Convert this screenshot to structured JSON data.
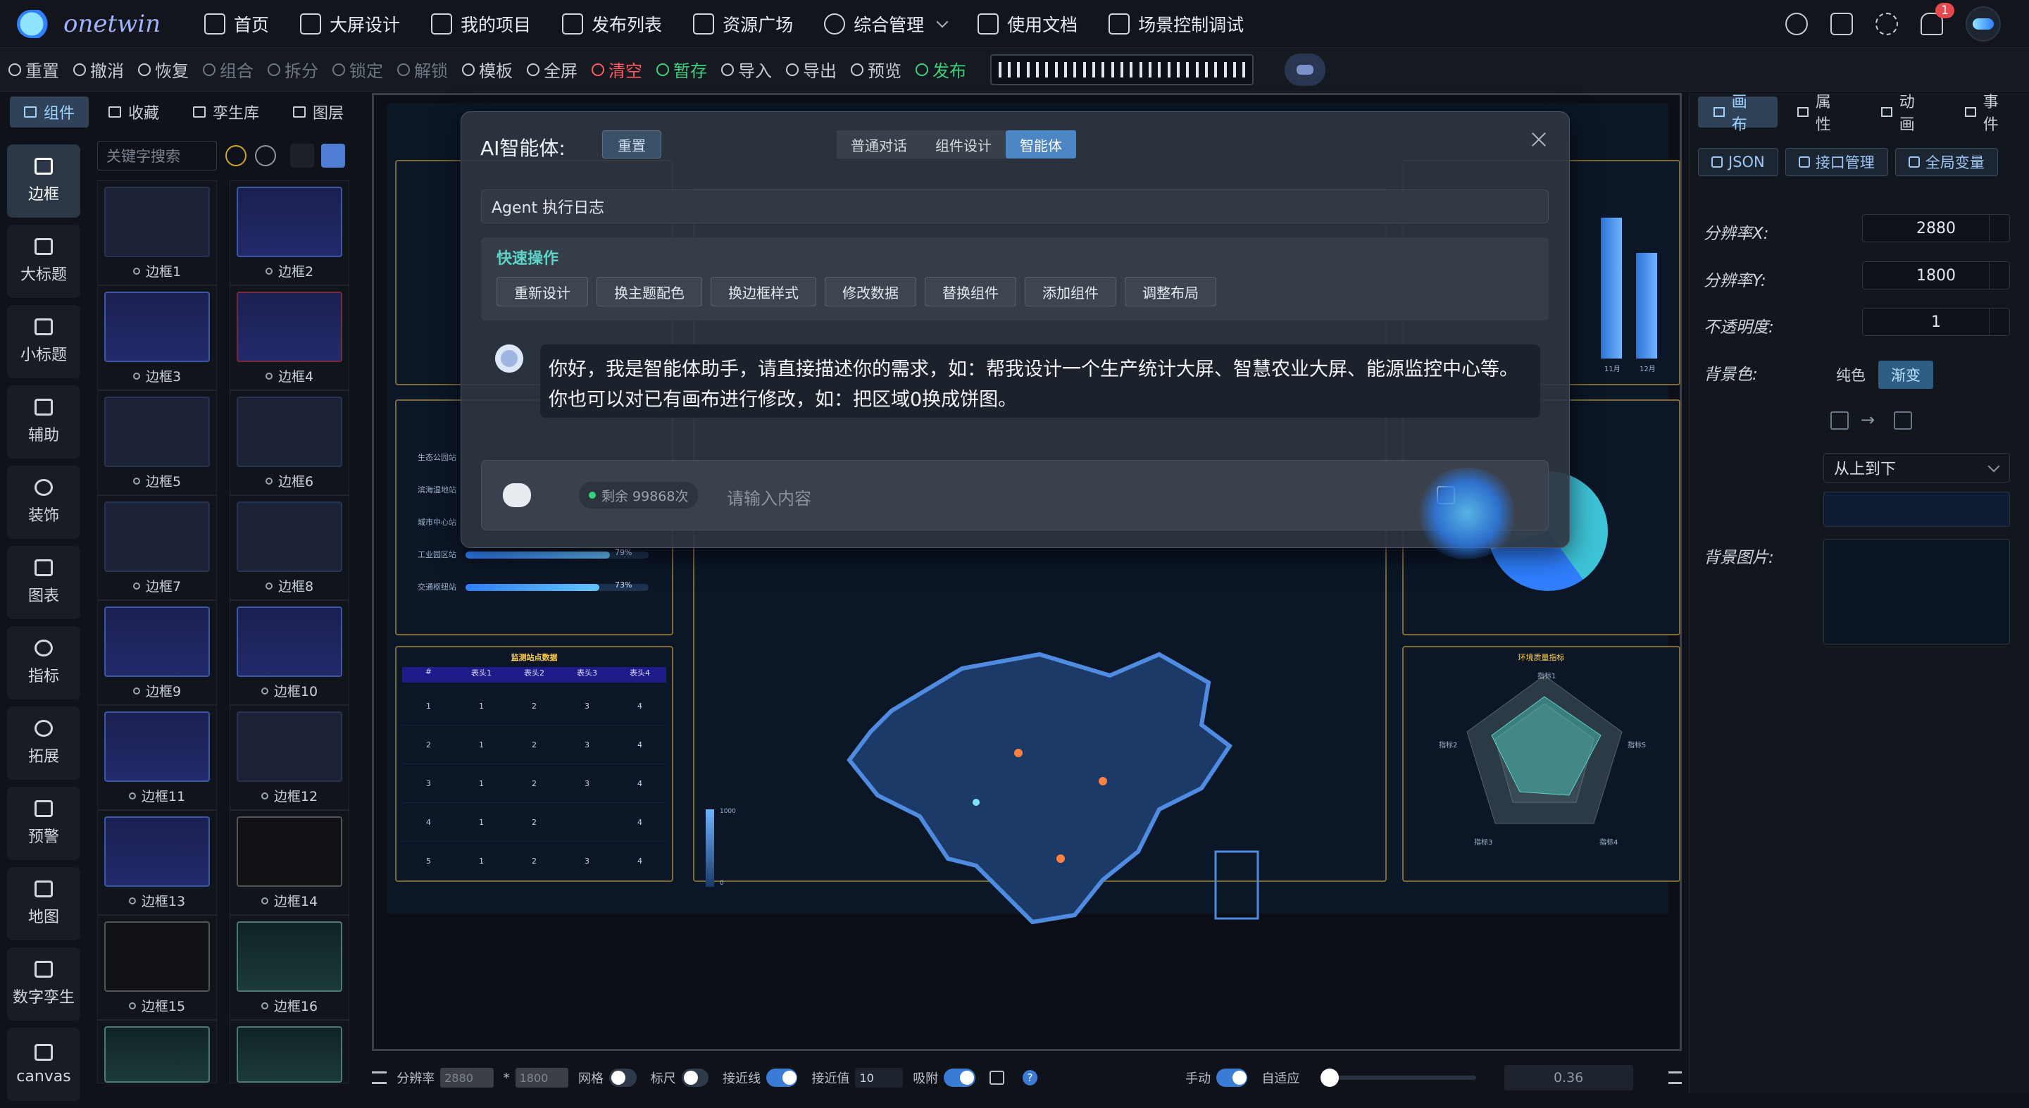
{
  "app": {
    "logo_text": "onetwin"
  },
  "nav": {
    "items": [
      {
        "label": "首页",
        "icon": "home-icon"
      },
      {
        "label": "大屏设计",
        "icon": "monitor-icon"
      },
      {
        "label": "我的项目",
        "icon": "project-icon"
      },
      {
        "label": "发布列表",
        "icon": "list-icon"
      },
      {
        "label": "资源广场",
        "icon": "grid-icon"
      },
      {
        "label": "综合管理",
        "icon": "gear-icon"
      },
      {
        "label": "使用文档",
        "icon": "doc-icon"
      },
      {
        "label": "场景控制调试",
        "icon": "screen-icon"
      }
    ],
    "notification_count": "1"
  },
  "toolbar": {
    "items": [
      {
        "label": "重置",
        "state": "normal"
      },
      {
        "label": "撤消",
        "state": "normal"
      },
      {
        "label": "恢复",
        "state": "normal"
      },
      {
        "label": "组合",
        "state": "disabled"
      },
      {
        "label": "拆分",
        "state": "disabled"
      },
      {
        "label": "锁定",
        "state": "disabled"
      },
      {
        "label": "解锁",
        "state": "disabled"
      },
      {
        "label": "模板",
        "state": "normal"
      },
      {
        "label": "全屏",
        "state": "normal"
      },
      {
        "label": "清空",
        "state": "danger"
      },
      {
        "label": "暂存",
        "state": "success"
      },
      {
        "label": "导入",
        "state": "normal"
      },
      {
        "label": "导出",
        "state": "normal"
      },
      {
        "label": "预览",
        "state": "normal"
      },
      {
        "label": "发布",
        "state": "success"
      }
    ]
  },
  "left_tabs": [
    {
      "label": "组件",
      "active": true
    },
    {
      "label": "收藏"
    },
    {
      "label": "孪生库"
    },
    {
      "label": "图层"
    }
  ],
  "categories": [
    "边框",
    "大标题",
    "小标题",
    "辅助",
    "装饰",
    "图表",
    "指标",
    "拓展",
    "预警",
    "地图",
    "数字孪生",
    "canvas"
  ],
  "search": {
    "placeholder": "关键字搜索"
  },
  "components": [
    "边框1",
    "边框2",
    "边框3",
    "边框4",
    "边框5",
    "边框6",
    "边框7",
    "边框8",
    "边框9",
    "边框10",
    "边框11",
    "边框12",
    "边框13",
    "边框14",
    "边框15",
    "边框16"
  ],
  "right_tabs": [
    {
      "label": "画布",
      "active": true
    },
    {
      "label": "属性"
    },
    {
      "label": "动画"
    },
    {
      "label": "事件"
    }
  ],
  "right_buttons": [
    "JSON",
    "接口管理",
    "全局变量"
  ],
  "props": {
    "res_x_label": "分辨率X:",
    "res_x": "2880",
    "res_y_label": "分辨率Y:",
    "res_y": "1800",
    "opacity_label": "不透明度:",
    "opacity": "1",
    "bg_label": "背景色:",
    "bg_solid": "纯色",
    "bg_gradient": "渐变",
    "arrow": "→",
    "gradient_dir": "从上到下",
    "bg_image_label": "背景图片:"
  },
  "bottom": {
    "resolution_label": "分辨率",
    "res_x": "2880",
    "star": "*",
    "res_y": "1800",
    "grid_label": "网格",
    "ruler_label": "标尺",
    "snap_label": "接近线",
    "snap_value_label": "接近值",
    "snap_value": "10",
    "attach_label": "吸附",
    "help": "?",
    "manual_label": "手动",
    "auto_label": "自适应",
    "zoom": "0.36"
  },
  "modal": {
    "title": "AI智能体:",
    "reset": "重置",
    "tabs": [
      {
        "label": "普通对话"
      },
      {
        "label": "组件设计"
      },
      {
        "label": "智能体",
        "active": true
      }
    ],
    "log_title": "Agent 执行日志",
    "quick_title": "快速操作",
    "quick_actions": [
      "重新设计",
      "换主题配色",
      "换边框样式",
      "修改数据",
      "替换组件",
      "添加组件",
      "调整布局"
    ],
    "message": "你好，我是智能体助手，请直接描述你的需求，如：帮我设计一个生产统计大屏、智慧农业大屏、能源监控中心等。你也可以对已有画布进行修改，如：把区域0换成饼图。",
    "remaining": "剩余 99868次",
    "placeholder": "请输入内容"
  },
  "canvas": {
    "list_items": [
      "生态公园站",
      "滨海湿地站",
      "城市中心站",
      "工业园区站",
      "交通枢纽站"
    ],
    "progress": [
      {
        "pct": 0.79,
        "label": "79%"
      },
      {
        "pct": 0.73,
        "label": "73%"
      }
    ],
    "table_title": "监测站点数据",
    "table_header": [
      "#",
      "表头1",
      "表头2",
      "表头3",
      "表头4"
    ],
    "table_rows": [
      [
        "1",
        "1",
        "2",
        "3",
        "4"
      ],
      [
        "2",
        "1",
        "2",
        "3",
        "4"
      ],
      [
        "3",
        "1",
        "2",
        "3",
        "4"
      ],
      [
        "4",
        "1",
        "2",
        "",
        "4"
      ],
      [
        "5",
        "1",
        "2",
        "3",
        "4"
      ]
    ],
    "radar_title": "环境质量指标",
    "radar_labels": [
      "指标1",
      "指标5",
      "指标4",
      "指标3",
      "指标2"
    ],
    "bar_labels": [
      "11月",
      "12月"
    ],
    "scale_max": "1000",
    "scale_min": "0"
  }
}
